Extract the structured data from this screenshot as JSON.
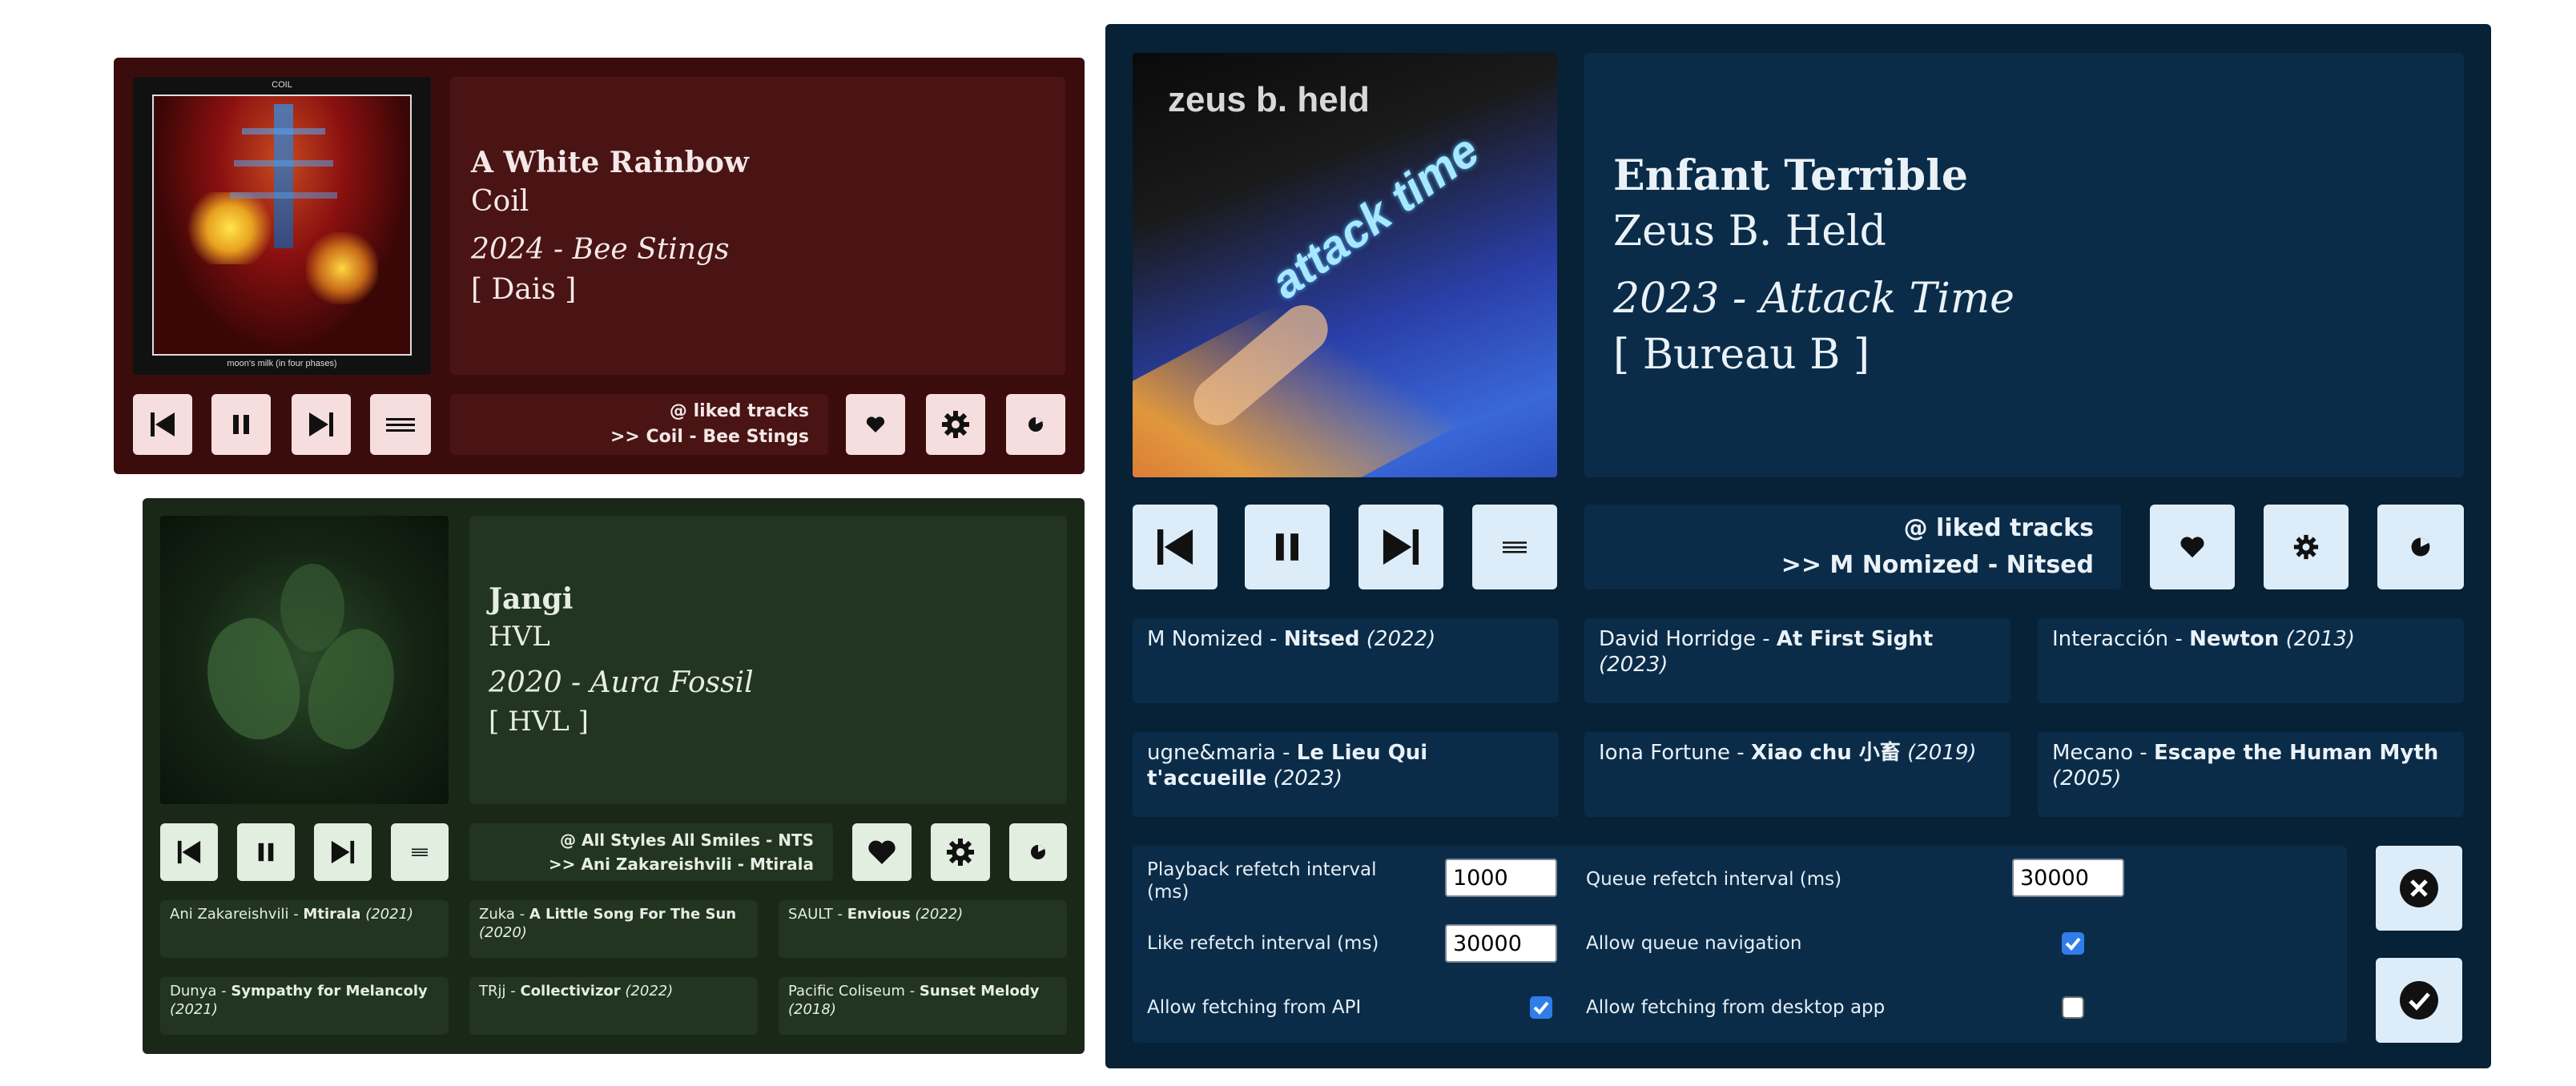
{
  "coil": {
    "album_art": {
      "top_text": "COIL",
      "bottom_text": "moon's milk (in four phases)"
    },
    "title": "A White Rainbow",
    "artist": "Coil",
    "year_album": "2024 - Bee Stings",
    "label": "[ Dais ]",
    "context_line1": "@ liked tracks",
    "context_line2": ">> Coil - Bee Stings"
  },
  "jangi": {
    "title": "Jangi",
    "artist": "HVL",
    "year_album": "2020 - Aura Fossil",
    "label": "[ HVL ]",
    "context_line1": "@ All Styles All Smiles - NTS",
    "context_line2": ">> Ani Zakareishvili - Mtirala",
    "queue": [
      {
        "artist": "Ani Zakareishvili",
        "title": "Mtirala",
        "year": "(2021)"
      },
      {
        "artist": "Zuka",
        "title": "A Little Song For The Sun",
        "year": "(2020)"
      },
      {
        "artist": "SAULT",
        "title": "Envious",
        "year": "(2022)"
      },
      {
        "artist": "Dunya",
        "title": "Sympathy for Melancoly",
        "year": "(2021)"
      },
      {
        "artist": "TRjj",
        "title": "Collectivizor",
        "year": "(2022)"
      },
      {
        "artist": "Pacific Coliseum",
        "title": "Sunset Melody",
        "year": "(2018)"
      }
    ]
  },
  "zeus": {
    "album_art": {
      "text1": "zeus b. held",
      "text2": "attack time"
    },
    "title": "Enfant Terrible",
    "artist": "Zeus B. Held",
    "year_album": "2023 - Attack Time",
    "label": "[ Bureau B ]",
    "context_line1": "@ liked tracks",
    "context_line2": ">> M Nomized - Nitsed",
    "queue": [
      {
        "artist": "M Nomized",
        "title": "Nitsed",
        "year": "(2022)"
      },
      {
        "artist": "David Horridge",
        "title": "At First Sight",
        "year": "(2023)"
      },
      {
        "artist": "Interacción",
        "title": "Newton",
        "year": "(2013)"
      },
      {
        "artist": "ugne&maria",
        "title": "Le Lieu Qui t'accueille",
        "year": "(2023)"
      },
      {
        "artist": "Iona Fortune",
        "title": "Xiao chu 小畜",
        "year": "(2019)"
      },
      {
        "artist": "Mecano",
        "title": "Escape the Human Myth",
        "year": "(2005)"
      }
    ],
    "settings": {
      "playback_label": "Playback refetch interval (ms)",
      "playback_value": "1000",
      "queue_label": "Queue refetch interval (ms)",
      "queue_value": "30000",
      "like_label": "Like refetch interval (ms)",
      "like_value": "30000",
      "allow_queue_label": "Allow queue navigation",
      "allow_queue_checked": true,
      "allow_api_label": "Allow fetching from API",
      "allow_api_checked": true,
      "allow_desktop_label": "Allow fetching from desktop app",
      "allow_desktop_checked": false
    }
  },
  "icons": [
    "previous-icon",
    "pause-icon",
    "next-icon",
    "menu-icon",
    "heart-icon",
    "gear-icon",
    "power-icon",
    "close-icon",
    "check-icon"
  ],
  "colors": {
    "coil_bg": "#3a0c0c",
    "coil_panel": "#4a1414",
    "coil_btn": "#f6dede",
    "jangi_bg": "#1a2818",
    "jangi_panel": "#213521",
    "jangi_btn": "#e2eee0",
    "zeus_bg": "#072136",
    "zeus_panel": "#0b2c48",
    "zeus_btn": "#dcecf8"
  }
}
